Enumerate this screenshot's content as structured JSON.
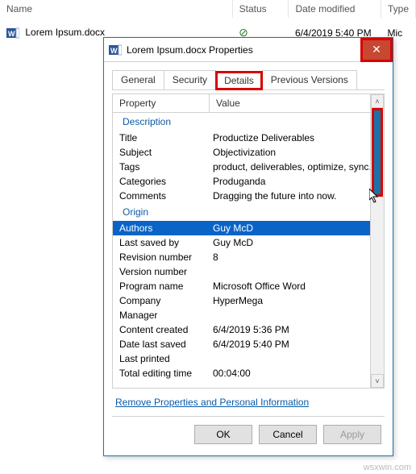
{
  "columns": {
    "name": "Name",
    "status": "Status",
    "date": "Date modified",
    "type": "Type"
  },
  "file": {
    "name": "Lorem Ipsum.docx",
    "date": "6/4/2019 5:40 PM",
    "type": "Mic"
  },
  "dialog": {
    "title": "Lorem Ipsum.docx Properties",
    "tabs": {
      "general": "General",
      "security": "Security",
      "details": "Details",
      "previous": "Previous Versions"
    },
    "head": {
      "property": "Property",
      "value": "Value"
    },
    "sections": {
      "description": "Description",
      "origin": "Origin"
    },
    "rows": {
      "title": {
        "p": "Title",
        "v": "Productize Deliverables"
      },
      "subject": {
        "p": "Subject",
        "v": "Objectivization"
      },
      "tags": {
        "p": "Tags",
        "v": "product, deliverables, optimize, sync..."
      },
      "categories": {
        "p": "Categories",
        "v": "Produganda"
      },
      "comments": {
        "p": "Comments",
        "v": "Dragging the future into now."
      },
      "authors": {
        "p": "Authors",
        "v": "Guy McD"
      },
      "lastsaved": {
        "p": "Last saved by",
        "v": "Guy McD"
      },
      "revision": {
        "p": "Revision number",
        "v": "8"
      },
      "version": {
        "p": "Version number",
        "v": ""
      },
      "program": {
        "p": "Program name",
        "v": "Microsoft Office Word"
      },
      "company": {
        "p": "Company",
        "v": "HyperMega"
      },
      "manager": {
        "p": "Manager",
        "v": ""
      },
      "created": {
        "p": "Content created",
        "v": "6/4/2019 5:36 PM"
      },
      "datesaved": {
        "p": "Date last saved",
        "v": "6/4/2019 5:40 PM"
      },
      "printed": {
        "p": "Last printed",
        "v": ""
      },
      "edittime": {
        "p": "Total editing time",
        "v": "00:04:00"
      }
    },
    "link": "Remove Properties and Personal Information",
    "buttons": {
      "ok": "OK",
      "cancel": "Cancel",
      "apply": "Apply"
    }
  },
  "watermark": "wsxwin.com"
}
